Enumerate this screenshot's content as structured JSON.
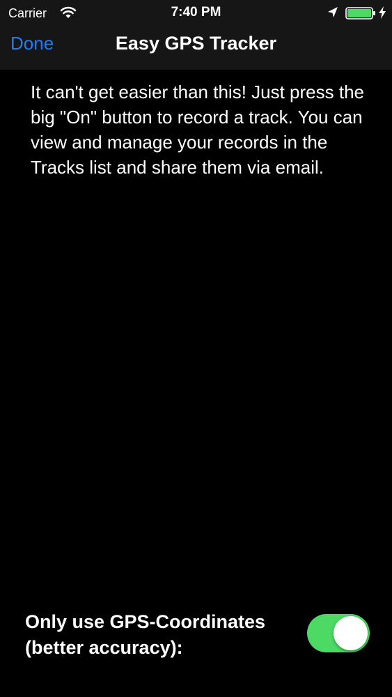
{
  "status_bar": {
    "carrier": "Carrier",
    "time": "7:40 PM",
    "wifi_icon": "wifi-icon",
    "location_icon": "location-arrow-icon",
    "battery_icon": "battery-icon",
    "charging_icon": "charging-bolt-icon",
    "battery_level": 1.0,
    "battery_color": "#4cd964"
  },
  "nav_bar": {
    "done_label": "Done",
    "title": "Easy GPS Tracker",
    "accent_color": "#1f7cf2"
  },
  "main": {
    "intro_text": "It can't get easier than this! Just press the big \"On\" button to record a track. You can view and manage your records in the Tracks list and share them via email."
  },
  "settings": {
    "gps_only_label": "Only use GPS-Coordinates (better accuracy):",
    "gps_only_enabled": true,
    "toggle_on_color": "#4cd964"
  }
}
